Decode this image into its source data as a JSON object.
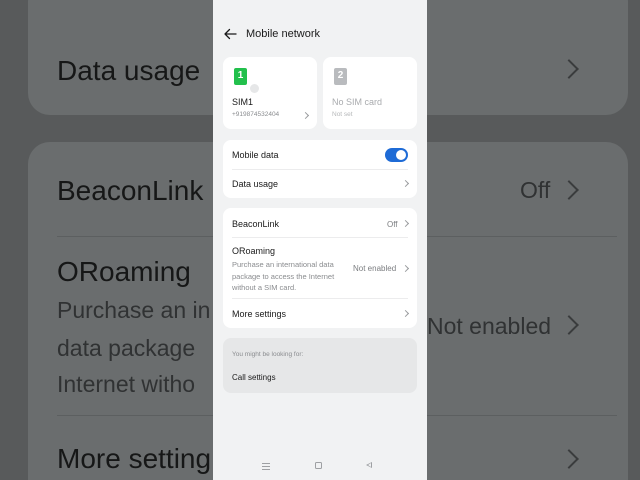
{
  "background": {
    "data_usage": "Data usage",
    "beaconlink": "BeaconLink",
    "beaconlink_value": "Off",
    "oroaming": "ORoaming",
    "oroaming_line1": "Purchase an in",
    "oroaming_line2": "data package",
    "oroaming_line3": "Internet witho",
    "oroaming_value": "Not enabled",
    "more_settings": "More setting"
  },
  "header": {
    "title": "Mobile network",
    "back_icon": "back-arrow-icon"
  },
  "sims": [
    {
      "badge": "1",
      "name": "SIM1",
      "number": "+919874532404",
      "color": "#22c04c"
    },
    {
      "badge": "2",
      "name": "No SIM card",
      "status": "Not set",
      "color": "#b9bbbe"
    }
  ],
  "data_card": {
    "mobile_data_label": "Mobile data",
    "mobile_data_enabled": true,
    "data_usage_label": "Data usage"
  },
  "services_card": {
    "beaconlink_label": "BeaconLink",
    "beaconlink_value": "Off",
    "oroaming_label": "ORoaming",
    "oroaming_description": "Purchase an international data package to access the Internet without a SIM card.",
    "oroaming_value": "Not enabled",
    "more_settings_label": "More settings"
  },
  "suggestions": {
    "label": "You might be looking for:",
    "link": "Call settings"
  },
  "navbar": {
    "icons": [
      "menu-icon",
      "home-icon",
      "back-icon"
    ]
  },
  "colors": {
    "accent": "#1e6bd6",
    "sim1": "#22c04c",
    "screen_bg": "#f1f2f3"
  }
}
